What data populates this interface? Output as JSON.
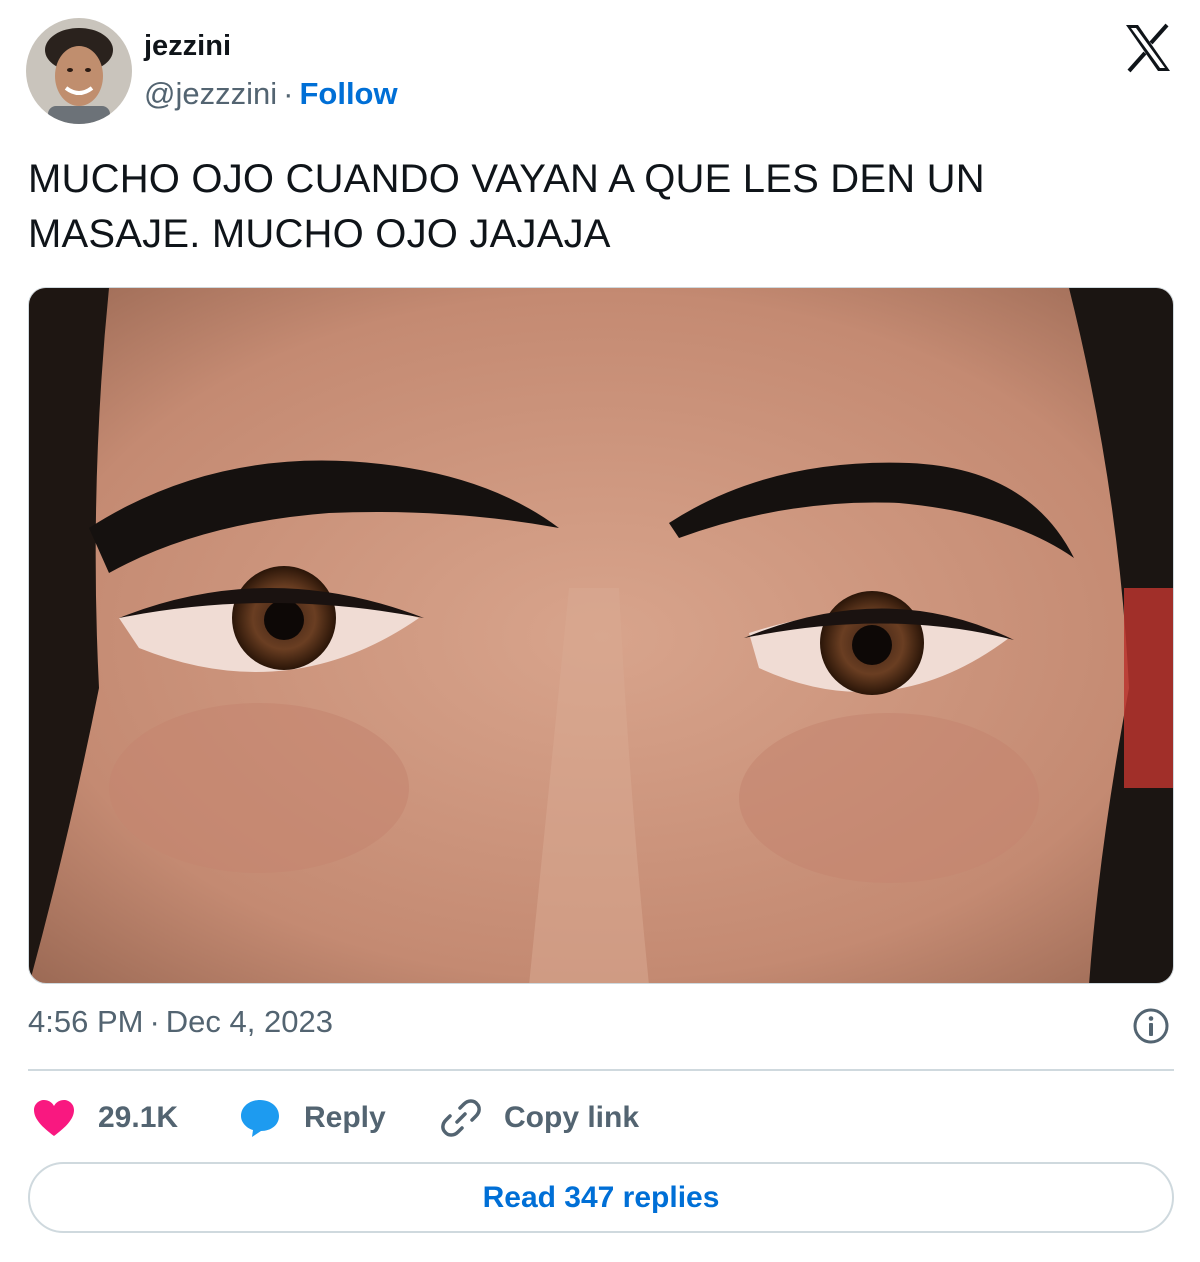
{
  "author": {
    "name": "jezzini",
    "handle": "@jezzzini",
    "separator": "·",
    "follow_label": "Follow"
  },
  "tweet": {
    "text": "MUCHO OJO CUANDO VAYAN A QUE LES DEN UN MASAJE. MUCHO OJO JAJAJA",
    "time": "4:56 PM",
    "date": "Dec 4, 2023",
    "meta_separator": "·"
  },
  "actions": {
    "likes": "29.1K",
    "reply_label": "Reply",
    "copy_label": "Copy link",
    "read_replies_label": "Read 347 replies"
  },
  "icons": {
    "brand": "x-logo-icon",
    "info": "info-icon",
    "like": "heart-icon",
    "reply": "speech-bubble-icon",
    "copy": "link-icon"
  },
  "colors": {
    "like": "#f91880",
    "reply": "#1d9bf0",
    "link": "#006fd6",
    "muted": "#536471",
    "text": "#0f1419",
    "border": "#cfd9de"
  }
}
